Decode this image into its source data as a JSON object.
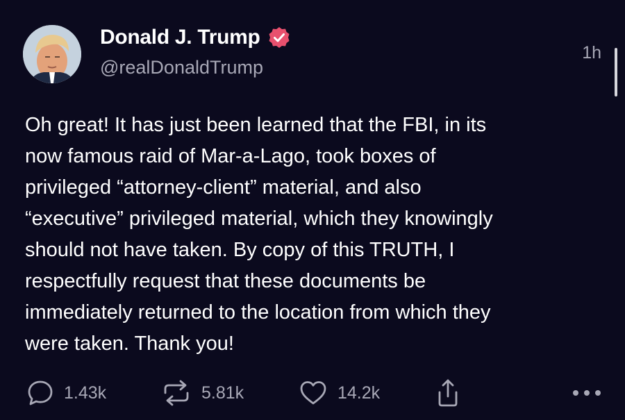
{
  "post": {
    "display_name": "Donald J. Trump",
    "handle": "@realDonaldTrump",
    "timestamp": "1h",
    "verified": true,
    "body": "Oh great! It has just been learned that the FBI, in its\nnow famous raid of Mar-a-Lago, took boxes of\nprivileged “attorney-client” material, and also\n“executive” privileged material, which they knowingly\nshould not have taken. By copy of this TRUTH, I\nrespectfully request that these documents be\nimmediately returned to the location from which they\nwere taken. Thank you!"
  },
  "actions": {
    "replies": "1.43k",
    "retruths": "5.81k",
    "likes": "14.2k"
  },
  "icons": {
    "reply": "reply-bubble-icon",
    "retruth": "retruth-arrows-icon",
    "like": "heart-icon",
    "share": "share-icon",
    "more": "ellipsis-icon",
    "verified": "verified-badge-icon"
  },
  "colors": {
    "background": "#0b0a1e",
    "text_primary": "#ffffff",
    "text_secondary": "#a8a8b6",
    "verified_badge": "#e8506e"
  }
}
